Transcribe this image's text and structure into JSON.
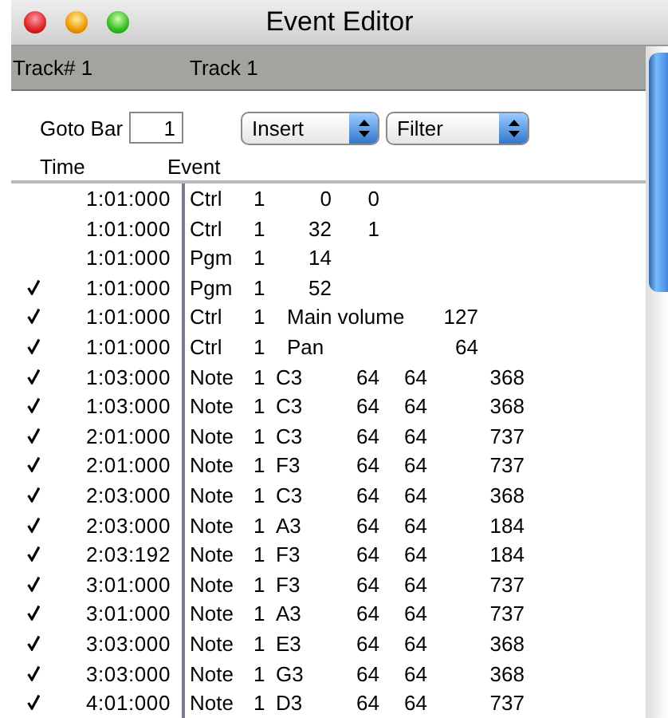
{
  "window": {
    "title": "Event Editor"
  },
  "track_bar": {
    "track_number": "Track# 1",
    "track_name": "Track 1"
  },
  "toolbar": {
    "goto_label": "Goto Bar",
    "goto_value": "1",
    "insert_menu": "Insert",
    "filter_menu": "Filter"
  },
  "columns": [
    "Time",
    "Event"
  ],
  "rows": [
    {
      "checked": false,
      "time": "1:01:000",
      "type": "Ctrl",
      "channel": "1",
      "kind": "ctrl",
      "number": "0",
      "value": "0"
    },
    {
      "checked": false,
      "time": "1:01:000",
      "type": "Ctrl",
      "channel": "1",
      "kind": "ctrl",
      "number": "32",
      "value": "1"
    },
    {
      "checked": false,
      "time": "1:01:000",
      "type": "Pgm",
      "channel": "1",
      "kind": "pgm",
      "number": "14"
    },
    {
      "checked": true,
      "time": "1:01:000",
      "type": "Pgm",
      "channel": "1",
      "kind": "pgm",
      "number": "52"
    },
    {
      "checked": true,
      "time": "1:01:000",
      "type": "Ctrl",
      "channel": "1",
      "kind": "named",
      "name": "Main volume",
      "value": "127"
    },
    {
      "checked": true,
      "time": "1:01:000",
      "type": "Ctrl",
      "channel": "1",
      "kind": "named",
      "name": "Pan",
      "value": "64"
    },
    {
      "checked": true,
      "time": "1:03:000",
      "type": "Note",
      "channel": "1",
      "kind": "note",
      "pitch": "C3",
      "velocity": "64",
      "release": "64",
      "length": "368"
    },
    {
      "checked": true,
      "time": "1:03:000",
      "type": "Note",
      "channel": "1",
      "kind": "note",
      "pitch": "C3",
      "velocity": "64",
      "release": "64",
      "length": "368"
    },
    {
      "checked": true,
      "time": "2:01:000",
      "type": "Note",
      "channel": "1",
      "kind": "note",
      "pitch": "C3",
      "velocity": "64",
      "release": "64",
      "length": "737"
    },
    {
      "checked": true,
      "time": "2:01:000",
      "type": "Note",
      "channel": "1",
      "kind": "note",
      "pitch": "F3",
      "velocity": "64",
      "release": "64",
      "length": "737"
    },
    {
      "checked": true,
      "time": "2:03:000",
      "type": "Note",
      "channel": "1",
      "kind": "note",
      "pitch": "C3",
      "velocity": "64",
      "release": "64",
      "length": "368"
    },
    {
      "checked": true,
      "time": "2:03:000",
      "type": "Note",
      "channel": "1",
      "kind": "note",
      "pitch": "A3",
      "velocity": "64",
      "release": "64",
      "length": "184"
    },
    {
      "checked": true,
      "time": "2:03:192",
      "type": "Note",
      "channel": "1",
      "kind": "note",
      "pitch": "F3",
      "velocity": "64",
      "release": "64",
      "length": "184"
    },
    {
      "checked": true,
      "time": "3:01:000",
      "type": "Note",
      "channel": "1",
      "kind": "note",
      "pitch": "F3",
      "velocity": "64",
      "release": "64",
      "length": "737"
    },
    {
      "checked": true,
      "time": "3:01:000",
      "type": "Note",
      "channel": "1",
      "kind": "note",
      "pitch": "A3",
      "velocity": "64",
      "release": "64",
      "length": "737"
    },
    {
      "checked": true,
      "time": "3:03:000",
      "type": "Note",
      "channel": "1",
      "kind": "note",
      "pitch": "E3",
      "velocity": "64",
      "release": "64",
      "length": "368"
    },
    {
      "checked": true,
      "time": "3:03:000",
      "type": "Note",
      "channel": "1",
      "kind": "note",
      "pitch": "G3",
      "velocity": "64",
      "release": "64",
      "length": "368"
    },
    {
      "checked": true,
      "time": "4:01:000",
      "type": "Note",
      "channel": "1",
      "kind": "note",
      "pitch": "D3",
      "velocity": "64",
      "release": "64",
      "length": "737"
    }
  ]
}
